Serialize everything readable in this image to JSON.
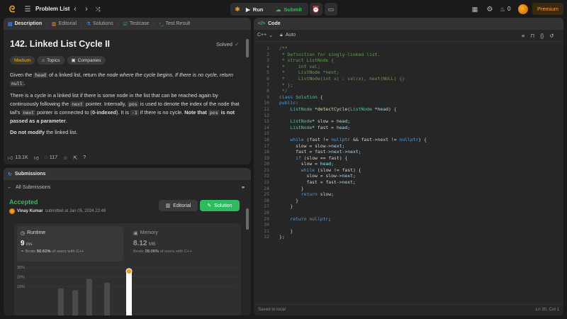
{
  "topbar": {
    "problem_list": "Problem List",
    "run": "Run",
    "submit": "Submit",
    "coins": "0",
    "premium": "Premium"
  },
  "left_tabs": [
    "Description",
    "Editorial",
    "Solutions",
    "Testcase",
    "Test Result"
  ],
  "problem": {
    "title": "142. Linked List Cycle II",
    "status": "Solved",
    "tags": [
      "Medium",
      "Topics",
      "Companies"
    ],
    "p1": {
      "a": "Given the ",
      "b": "head",
      "c": " of a linked list, return ",
      "d": "the node where the cycle begins. If there is no cycle, return ",
      "e": "null",
      "f": "."
    },
    "p2": {
      "a": "There is a cycle in a linked list if there is some node in the list that can be reached again by continuously following the ",
      "b": "next",
      "c": " pointer. Internally, ",
      "d": "pos",
      "e": " is used to denote the index of the node that tail's ",
      "f": "next",
      "g": " pointer is connected to (",
      "h": "0-indexed",
      "i": "). It is ",
      "j": "-1",
      "k": " if there is no cycle. ",
      "l": "Note that ",
      "m": "pos",
      "n": " is not passed as a parameter",
      "o": "."
    },
    "p3": {
      "a": "Do not modify",
      "b": " the linked list."
    },
    "likes": "13.1K",
    "comments": "117"
  },
  "submissions": {
    "title": "Submissions",
    "back": "All Submissions",
    "status": "Accepted",
    "user": "Vinay Kumar",
    "submitted_at": "submitted at Jan 05, 2024 22:49",
    "editorial_btn": "Editorial",
    "solution_btn": "Solution",
    "runtime_label": "Runtime",
    "runtime_value": "9",
    "runtime_unit": "ms",
    "runtime_beats_pre": "Beats ",
    "runtime_beats": "50.61%",
    "runtime_beats_post": " of users with C++",
    "memory_label": "Memory",
    "memory_value": "8.12",
    "memory_unit": "MB",
    "memory_beats_pre": "Beats ",
    "memory_beats": "28.06%",
    "memory_beats_post": " of users with C++"
  },
  "chart_data": {
    "type": "bar",
    "ytick_labels": [
      "30%",
      "20%",
      "10%"
    ],
    "yticks": [
      30,
      20,
      10
    ],
    "values": [
      8,
      6,
      18,
      14,
      0,
      28
    ],
    "highlight_index": 5
  },
  "code_panel": {
    "title": "Code",
    "language": "C++",
    "mode": "Auto",
    "saved": "Saved to local",
    "cursor": "Ln 30, Col 1"
  },
  "code_lines": [
    "/**",
    " * Definition for singly-linked list.",
    " * struct ListNode {",
    " *     int val;",
    " *     ListNode *next;",
    " *     ListNode(int x) : val(x), next(NULL) {}",
    " * };",
    " */",
    "class Solution {",
    "public:",
    "    ListNode *detectCycle(ListNode *head) {",
    "",
    "    ListNode* slow = head;",
    "    ListNode* fast = head;",
    "",
    "    while (fast != nullptr && fast->next != nullptr) {",
    "      slow = slow->next;",
    "      fast = fast->next->next;",
    "      if (slow == fast) {",
    "        slow = head;",
    "        while (slow != fast) {",
    "          slow = slow->next;",
    "          fast = fast->next;",
    "        }",
    "        return slow;",
    "      }",
    "    }",
    "",
    "    return nullptr;",
    "",
    "    }",
    "};"
  ]
}
